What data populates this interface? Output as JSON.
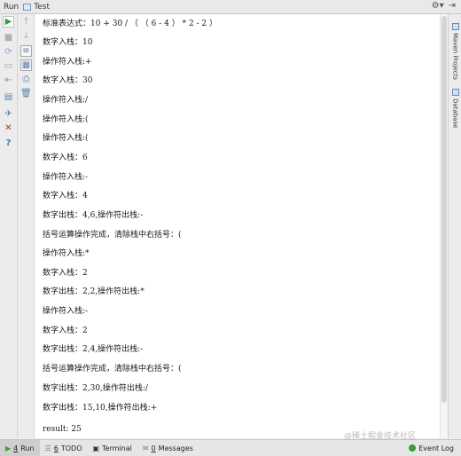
{
  "window": {
    "run_label": "Run",
    "config_name": "Test"
  },
  "console": {
    "lines": [
      "标准表达式：10 + 30 / （ （ 6 - 4 ） * 2 - 2 ）",
      "数字入栈：10",
      "操作符入栈:+",
      "数字入栈：30",
      "操作符入栈:/",
      "操作符入栈:(",
      "操作符入栈:(",
      "数字入栈：6",
      "操作符入栈:-",
      "数字入栈：4",
      "数字出栈：4,6,操作符出栈:-",
      "括号运算操作完成，清除栈中右括号：(",
      "操作符入栈:*",
      "数字入栈：2",
      "数字出栈：2,2,操作符出栈:*",
      "操作符入栈:-",
      "数字入栈：2",
      "数字出栈：2,4,操作符出栈:-",
      "括号运算操作完成，清除栈中右括号：(",
      "数字出栈：2,30,操作符出栈:/",
      "数字出栈：15,10,操作符出栈:+",
      "result: 25"
    ]
  },
  "right_tabs": {
    "maven": "Maven Projects",
    "database": "Database"
  },
  "status_bar": {
    "run_num": "4",
    "run": "Run",
    "todo_num": "6",
    "todo": "TODO",
    "terminal": "Terminal",
    "messages_num": "0",
    "messages": "Messages",
    "event_log": "Event Log"
  },
  "watermark": "@稀土掘金技术社区",
  "colors": {
    "run_green": "#3a9d3a",
    "stop_red": "#cc2222",
    "console_bg": "#ffffff"
  },
  "icons": [
    "run-icon",
    "stop-icon",
    "rerun-icon",
    "debug-icon",
    "pin-icon",
    "close-icon",
    "help-icon",
    "up-icon",
    "down-icon",
    "soft-wrap-icon",
    "scroll-end-icon",
    "print-icon",
    "clear-icon",
    "gear-icon"
  ]
}
